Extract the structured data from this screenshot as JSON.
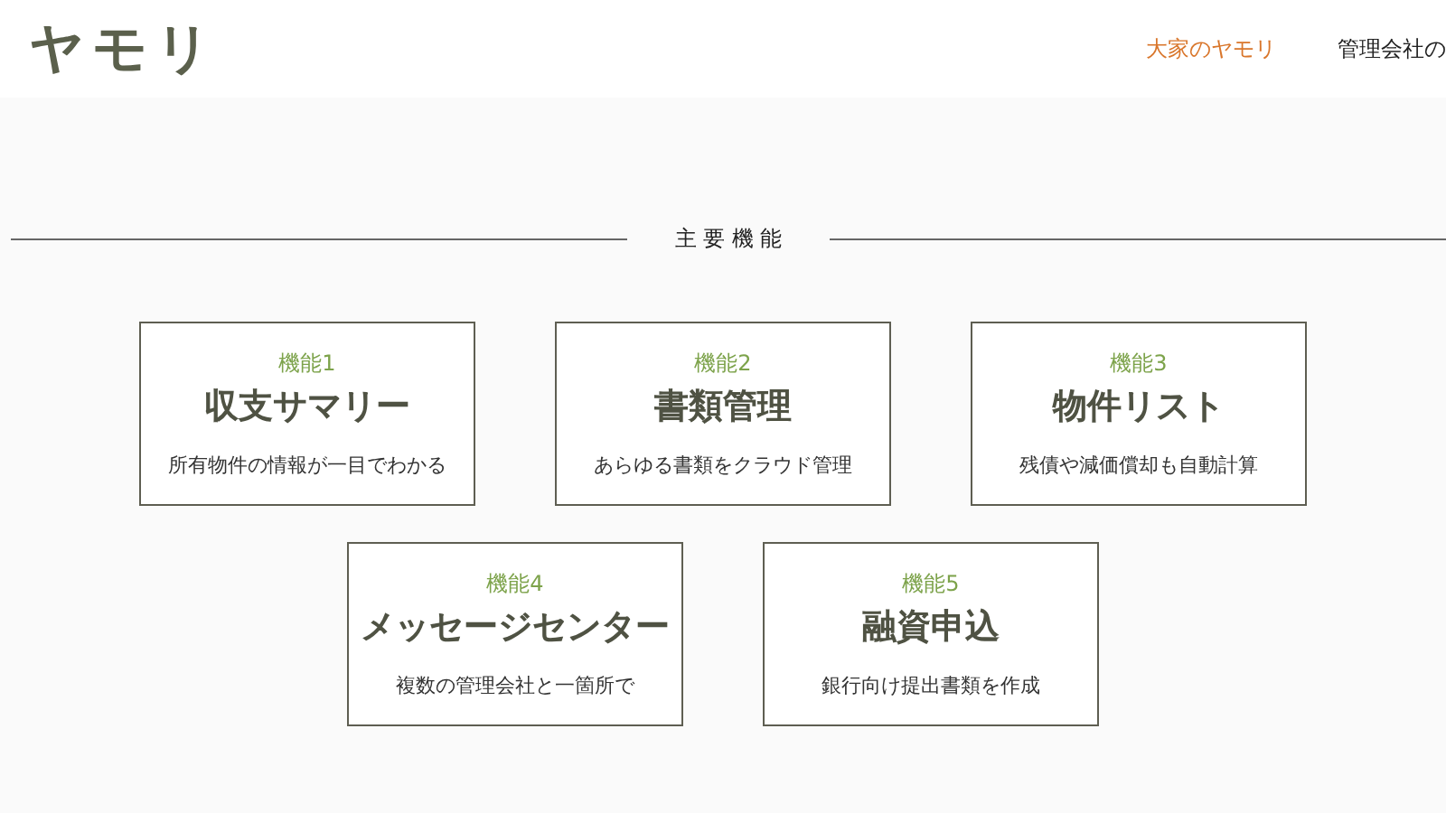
{
  "header": {
    "logo": "ヤモリ",
    "nav": [
      {
        "label": "大家のヤモリ",
        "selected": true
      },
      {
        "label": "管理会社の",
        "selected": false
      }
    ]
  },
  "section": {
    "title": "主 要 機 能"
  },
  "features": [
    {
      "number": "機能1",
      "title": "収支サマリー",
      "description": "所有物件の情報が一目でわかる"
    },
    {
      "number": "機能2",
      "title": "書類管理",
      "description": "あらゆる書類をクラウド管理"
    },
    {
      "number": "機能3",
      "title": "物件リスト",
      "description": "残債や減価償却も自動計算"
    },
    {
      "number": "機能4",
      "title": "メッセージセンター",
      "description": "複数の管理会社と一箇所で"
    },
    {
      "number": "機能5",
      "title": "融資申込",
      "description": "銀行向け提出書類を作成"
    }
  ]
}
